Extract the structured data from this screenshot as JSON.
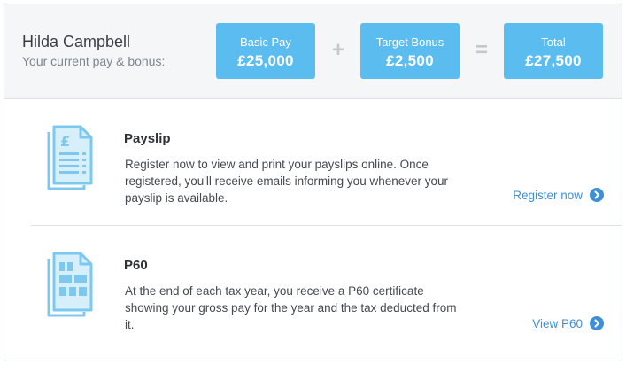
{
  "employee": {
    "name": "Hilda Campbell",
    "subtitle": "Your current pay & bonus:"
  },
  "pay": {
    "basic": {
      "label": "Basic Pay",
      "value": "£25,000"
    },
    "bonus": {
      "label": "Target Bonus",
      "value": "£2,500"
    },
    "total": {
      "label": "Total",
      "value": "£27,500"
    },
    "plus_symbol": "+",
    "equals_symbol": "="
  },
  "sections": {
    "payslip": {
      "icon": "payslip-document-icon",
      "title": "Payslip",
      "description": "Register now to view and print your payslips online. Once registered, you'll receive emails informing you whenever your payslip is available.",
      "link_label": "Register now"
    },
    "p60": {
      "icon": "p60-document-icon",
      "title": "P60",
      "description": "At the end of each tax year, you receive a P60 certificate showing your gross pay for the year and the tax deducted from it.",
      "link_label": "View P60"
    }
  },
  "colors": {
    "accent_box": "#5bbcf0",
    "link": "#3f8fd6",
    "icon": "#7cc8ee",
    "icon_fill": "#d6effb"
  }
}
